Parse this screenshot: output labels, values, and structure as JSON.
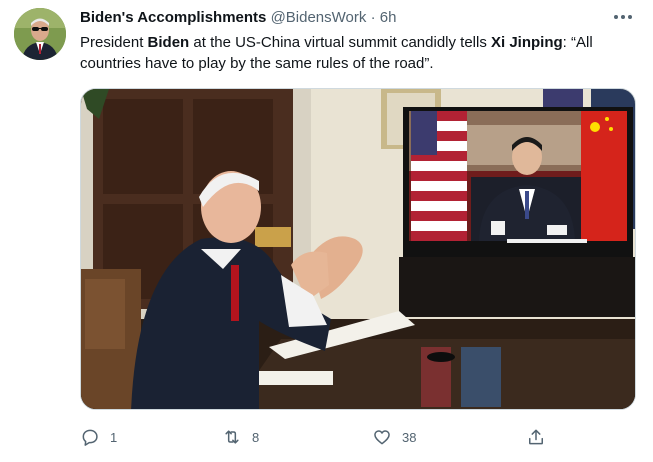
{
  "tweet": {
    "author_name": "Biden's Accomplishments",
    "handle": "@BidensWork",
    "separator": "·",
    "time": "6h",
    "text_parts": {
      "p1": "President ",
      "p2": "Biden",
      "p3": " at the US-China virtual summit candidly tells ",
      "p4": "Xi Jinping",
      "p5": ": “All countries have to play by the same rules of the road”."
    }
  },
  "actions": {
    "reply_count": "1",
    "retweet_count": "8",
    "like_count": "38"
  },
  "icons": {
    "more": "more-icon",
    "reply": "reply-icon",
    "retweet": "retweet-icon",
    "like": "heart-icon",
    "share": "share-icon"
  },
  "colors": {
    "text": "#0f1419",
    "secondary": "#536471",
    "border": "#cfd9de"
  }
}
